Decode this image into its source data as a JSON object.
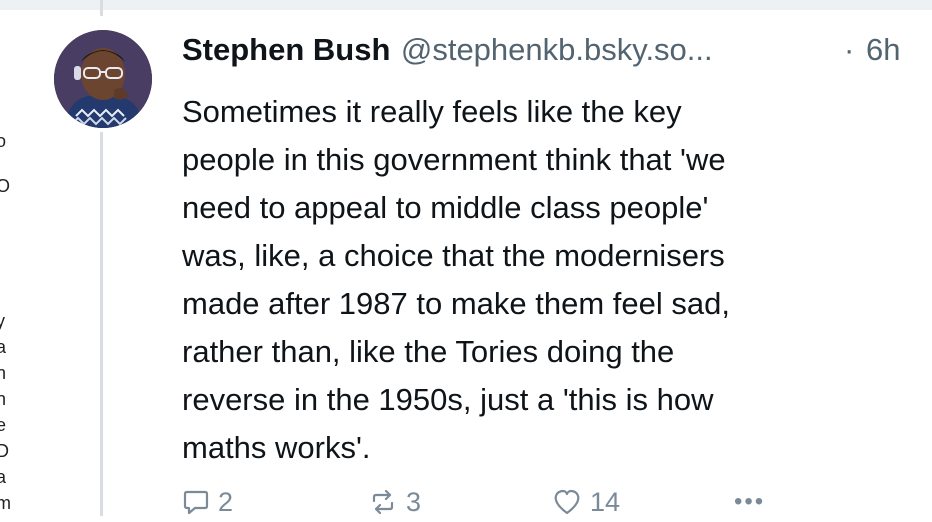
{
  "post": {
    "author_name": "Stephen Bush",
    "handle": "@stephenkb.bsky.so...",
    "separator": "·",
    "time_ago": "6h",
    "lines": [
      "Sometimes it really feels like the key",
      "people in this government think that 'we",
      "need to appeal to middle class people'",
      "was, like, a choice that the modernisers",
      "made after 1987 to make them feel sad,",
      "rather than, like the Tories doing the",
      "reverse in the 1950s, just a 'this is how",
      "maths works'."
    ]
  },
  "actions": {
    "reply_count": "2",
    "repost_count": "3",
    "like_count": "14",
    "more_label": "•••"
  },
  "left_edge_fragments": [
    "o",
    "O",
    "y",
    "a",
    "n",
    "n",
    "e",
    "D",
    "a",
    "m"
  ],
  "colors": {
    "text": "#0f1419",
    "secondary": "#536471",
    "icon": "#7b8a99",
    "thread_line": "#d7dde3"
  },
  "icons": [
    "reply-icon",
    "repost-icon",
    "like-icon",
    "more-icon"
  ]
}
